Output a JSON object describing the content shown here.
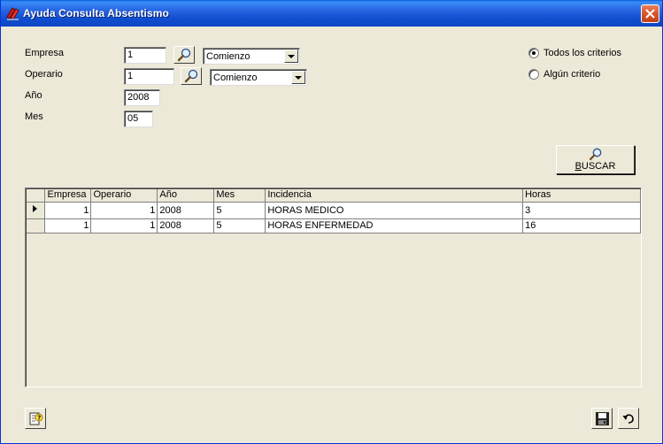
{
  "window": {
    "title": "Ayuda Consulta Absentismo",
    "app_icon": "app-icon",
    "close_icon": "close-icon"
  },
  "form": {
    "empresa": {
      "label": "Empresa",
      "value": "1",
      "combo": "Comienzo"
    },
    "operario": {
      "label": "Operario",
      "value": "1",
      "combo": "Comienzo"
    },
    "anio": {
      "label": "Año",
      "value": "2008"
    },
    "mes": {
      "label": "Mes",
      "value": "05"
    }
  },
  "criteria": {
    "todos": {
      "label": "Todos los criterios",
      "selected": true
    },
    "alguno": {
      "label": "Algún criterio",
      "selected": false
    }
  },
  "buscar": {
    "label": "BUSCAR",
    "icon": "magnifier-icon"
  },
  "grid": {
    "columns": [
      "Empresa",
      "Operario",
      "Año",
      "Mes",
      "Incidencia",
      "Horas"
    ],
    "rows": [
      {
        "current": true,
        "empresa": "1",
        "operario": "1",
        "anio": "2008",
        "mes": "5",
        "incidencia": "HORAS MEDICO",
        "horas": "3"
      },
      {
        "current": false,
        "empresa": "1",
        "operario": "1",
        "anio": "2008",
        "mes": "5",
        "incidencia": "HORAS ENFERMEDAD",
        "horas": "16"
      }
    ]
  },
  "footer": {
    "help_icon": "help-icon",
    "save_icon": "save-icon",
    "undo_icon": "undo-icon"
  }
}
